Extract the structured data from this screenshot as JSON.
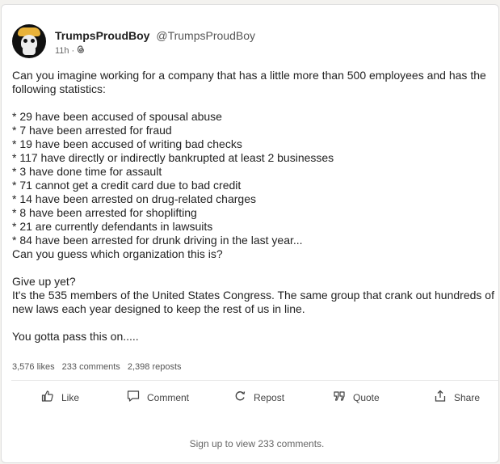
{
  "post": {
    "author": {
      "display_name": "TrumpsProudBoy",
      "handle": "@TrumpsProudBoy",
      "time": "11h",
      "time_separator": "·",
      "avatar_icon": "skull-avatar"
    },
    "lines": [
      "Can you imagine working for a company that has a little more than 500 employees and has the following statistics:",
      "",
      "* 29 have been accused of spousal abuse",
      "* 7 have been arrested for fraud",
      "* 19 have been accused of writing bad checks",
      "* 117 have directly or indirectly bankrupted at least 2 businesses",
      "* 3 have done time for assault",
      "* 71 cannot get a credit card due to bad credit",
      "* 14 have been arrested on drug-related charges",
      "* 8 have been arrested for shoplifting",
      "* 21 are currently defendants in lawsuits",
      "* 84 have been arrested for drunk driving in the last year...",
      "Can you guess which organization this is?",
      "",
      "Give up yet?",
      "It's the 535 members of the United States Congress. The same group that crank out hundreds of new laws each year designed to keep the rest of us in line.",
      "",
      "You gotta pass this on....."
    ],
    "stats": {
      "likes": "3,576 likes",
      "comments": "233 comments",
      "reposts": "2,398 reposts"
    },
    "actions": {
      "like": "Like",
      "comment": "Comment",
      "repost": "Repost",
      "quote": "Quote",
      "share": "Share"
    },
    "signup_text": "Sign up to view 233 comments."
  },
  "colors": {
    "page_bg": "#f3f2ef",
    "card_bg": "#ffffff",
    "text": "#222222",
    "muted": "#555555"
  }
}
